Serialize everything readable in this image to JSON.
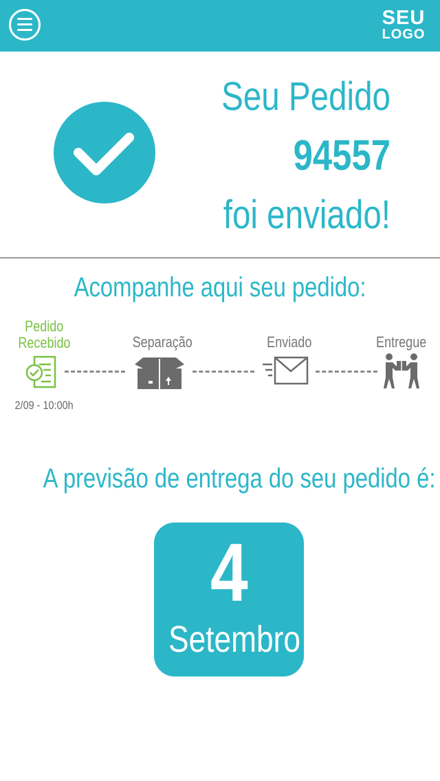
{
  "header": {
    "menu_icon": "hamburger-menu-icon",
    "logo_line1": "SEU",
    "logo_line2": "LOGO",
    "brand_color": "#2bb7c8"
  },
  "confirmation": {
    "icon": "checkmark-icon",
    "title": "Seu Pedido",
    "order_number": "94557",
    "status": "foi enviado!"
  },
  "tracking": {
    "title": "Acompanhe aqui seu pedido:",
    "steps": [
      {
        "label_line1": "Pedido",
        "label_line2": "Recebido",
        "icon": "document-check-icon",
        "date": "2/09 - 10:00h",
        "active": true,
        "color": "#7ac143"
      },
      {
        "label_line1": "Separação",
        "icon": "box-icon",
        "active": false
      },
      {
        "label_line1": "Enviado",
        "icon": "envelope-icon",
        "active": false
      },
      {
        "label_line1": "Entregue",
        "icon": "delivery-handover-icon",
        "active": false
      }
    ]
  },
  "forecast": {
    "text": "A previsão de entrega do seu pedido é:",
    "day": "4",
    "month": "Setembro"
  }
}
